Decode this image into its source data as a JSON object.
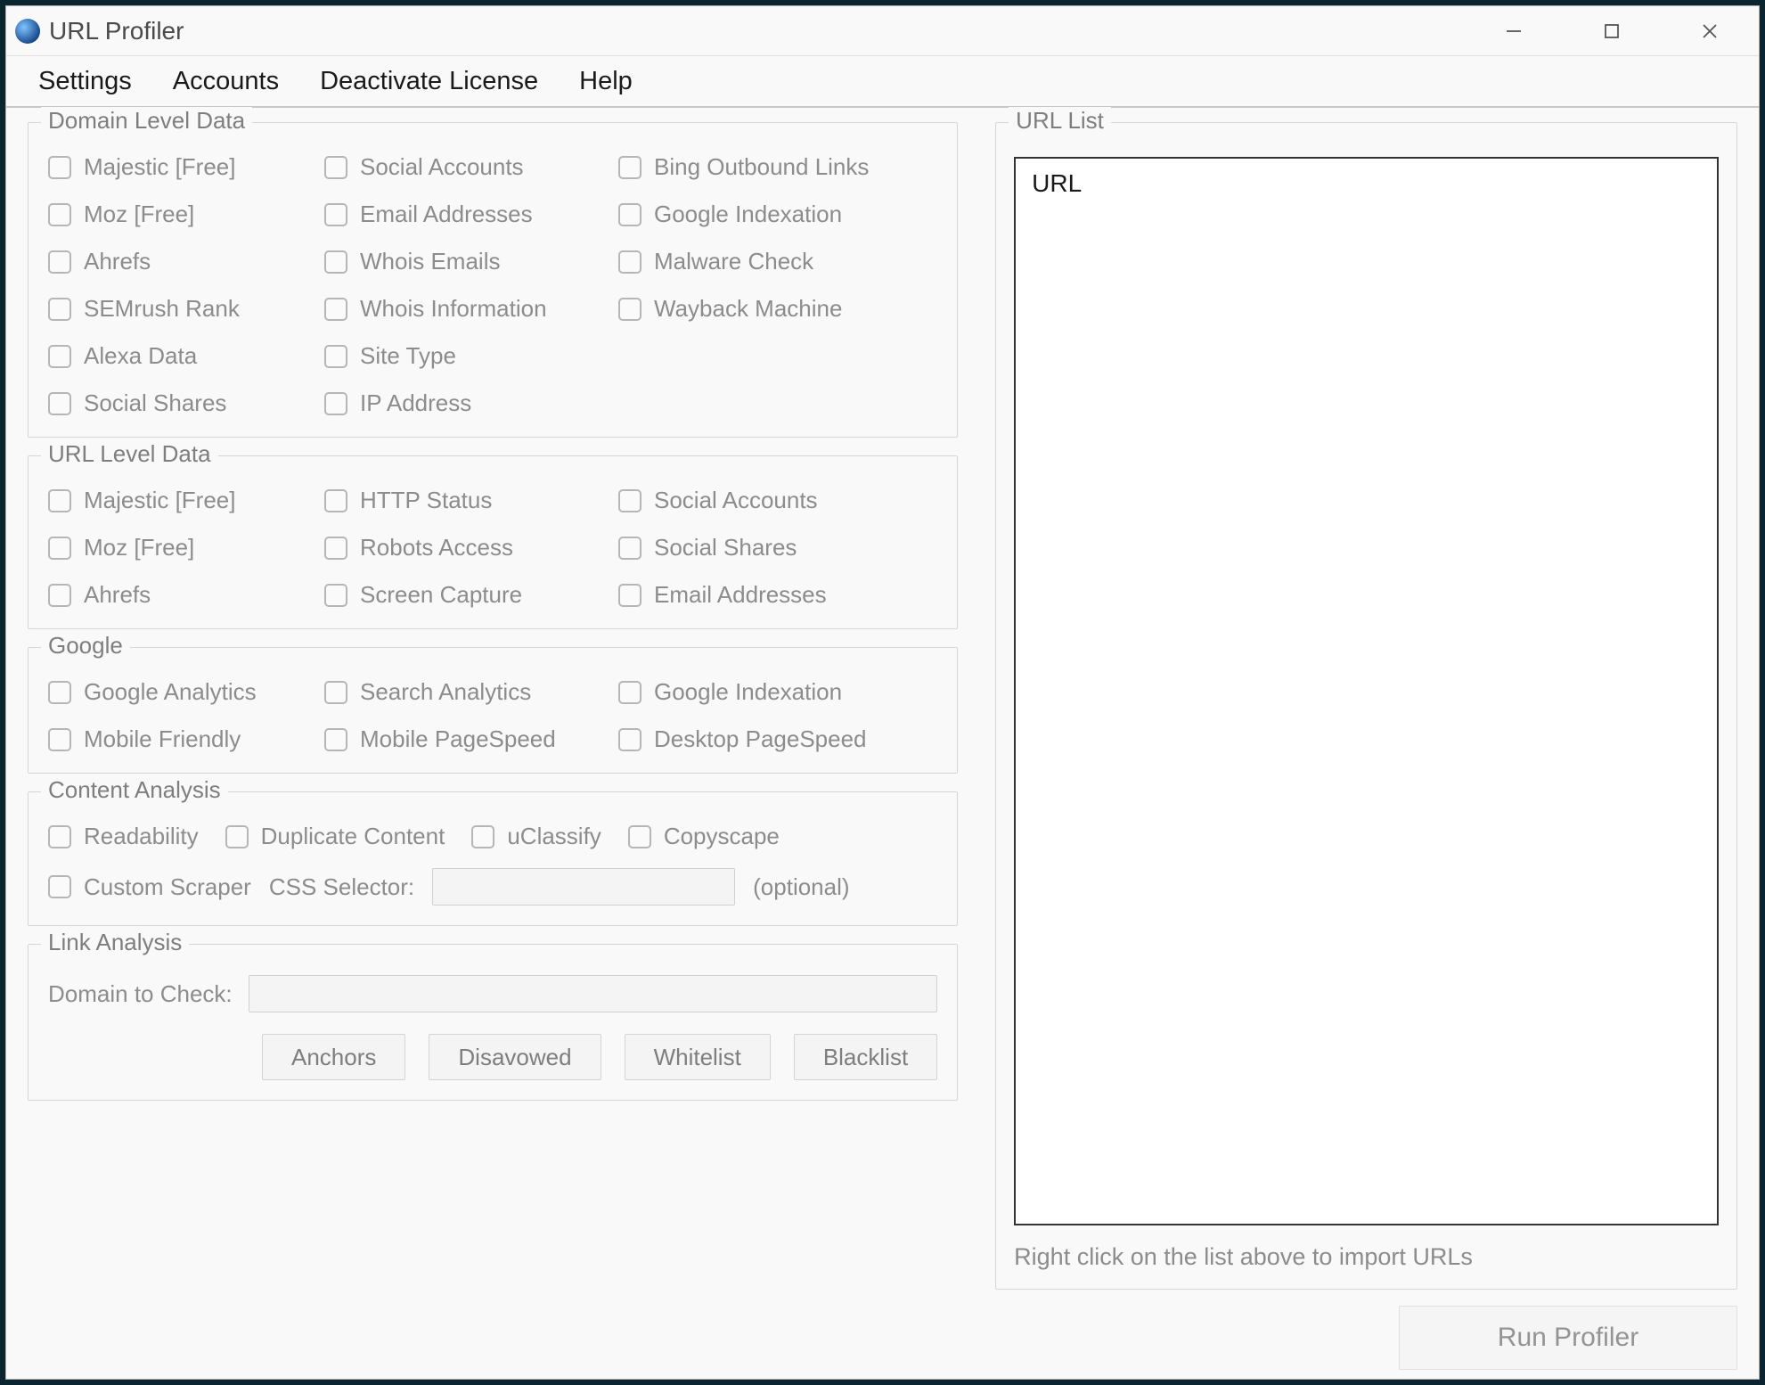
{
  "window": {
    "title": "URL Profiler"
  },
  "menu": {
    "settings": "Settings",
    "accounts": "Accounts",
    "deactivate": "Deactivate License",
    "help": "Help"
  },
  "groups": {
    "domain": {
      "title": "Domain Level Data",
      "items": {
        "majestic": "Majestic [Free]",
        "social_accounts": "Social Accounts",
        "bing_outbound": "Bing Outbound Links",
        "moz": "Moz [Free]",
        "email_addresses": "Email Addresses",
        "google_indexation": "Google Indexation",
        "ahrefs": "Ahrefs",
        "whois_emails": "Whois Emails",
        "malware_check": "Malware Check",
        "semrush_rank": "SEMrush Rank",
        "whois_information": "Whois Information",
        "wayback_machine": "Wayback Machine",
        "alexa_data": "Alexa Data",
        "site_type": "Site Type",
        "social_shares": "Social Shares",
        "ip_address": "IP Address"
      }
    },
    "url": {
      "title": "URL Level Data",
      "items": {
        "majestic": "Majestic [Free]",
        "http_status": "HTTP Status",
        "social_accounts": "Social Accounts",
        "moz": "Moz [Free]",
        "robots_access": "Robots Access",
        "social_shares": "Social Shares",
        "ahrefs": "Ahrefs",
        "screen_capture": "Screen Capture",
        "email_addresses": "Email Addresses"
      }
    },
    "google": {
      "title": "Google",
      "items": {
        "analytics": "Google Analytics",
        "search_analytics": "Search Analytics",
        "google_indexation": "Google Indexation",
        "mobile_friendly": "Mobile Friendly",
        "mobile_pagespeed": "Mobile PageSpeed",
        "desktop_pagespeed": "Desktop PageSpeed"
      }
    },
    "content": {
      "title": "Content Analysis",
      "items": {
        "readability": "Readability",
        "duplicate_content": "Duplicate Content",
        "uclassify": "uClassify",
        "copyscape": "Copyscape",
        "custom_scraper": "Custom Scraper"
      },
      "css_selector_label": "CSS Selector:",
      "css_selector_hint": "(optional)"
    },
    "link": {
      "title": "Link Analysis",
      "domain_to_check_label": "Domain to Check:",
      "buttons": {
        "anchors": "Anchors",
        "disavowed": "Disavowed",
        "whitelist": "Whitelist",
        "blacklist": "Blacklist"
      }
    },
    "url_list": {
      "title": "URL List",
      "header": "URL",
      "hint": "Right click on the list above to import URLs"
    }
  },
  "actions": {
    "run": "Run Profiler"
  }
}
